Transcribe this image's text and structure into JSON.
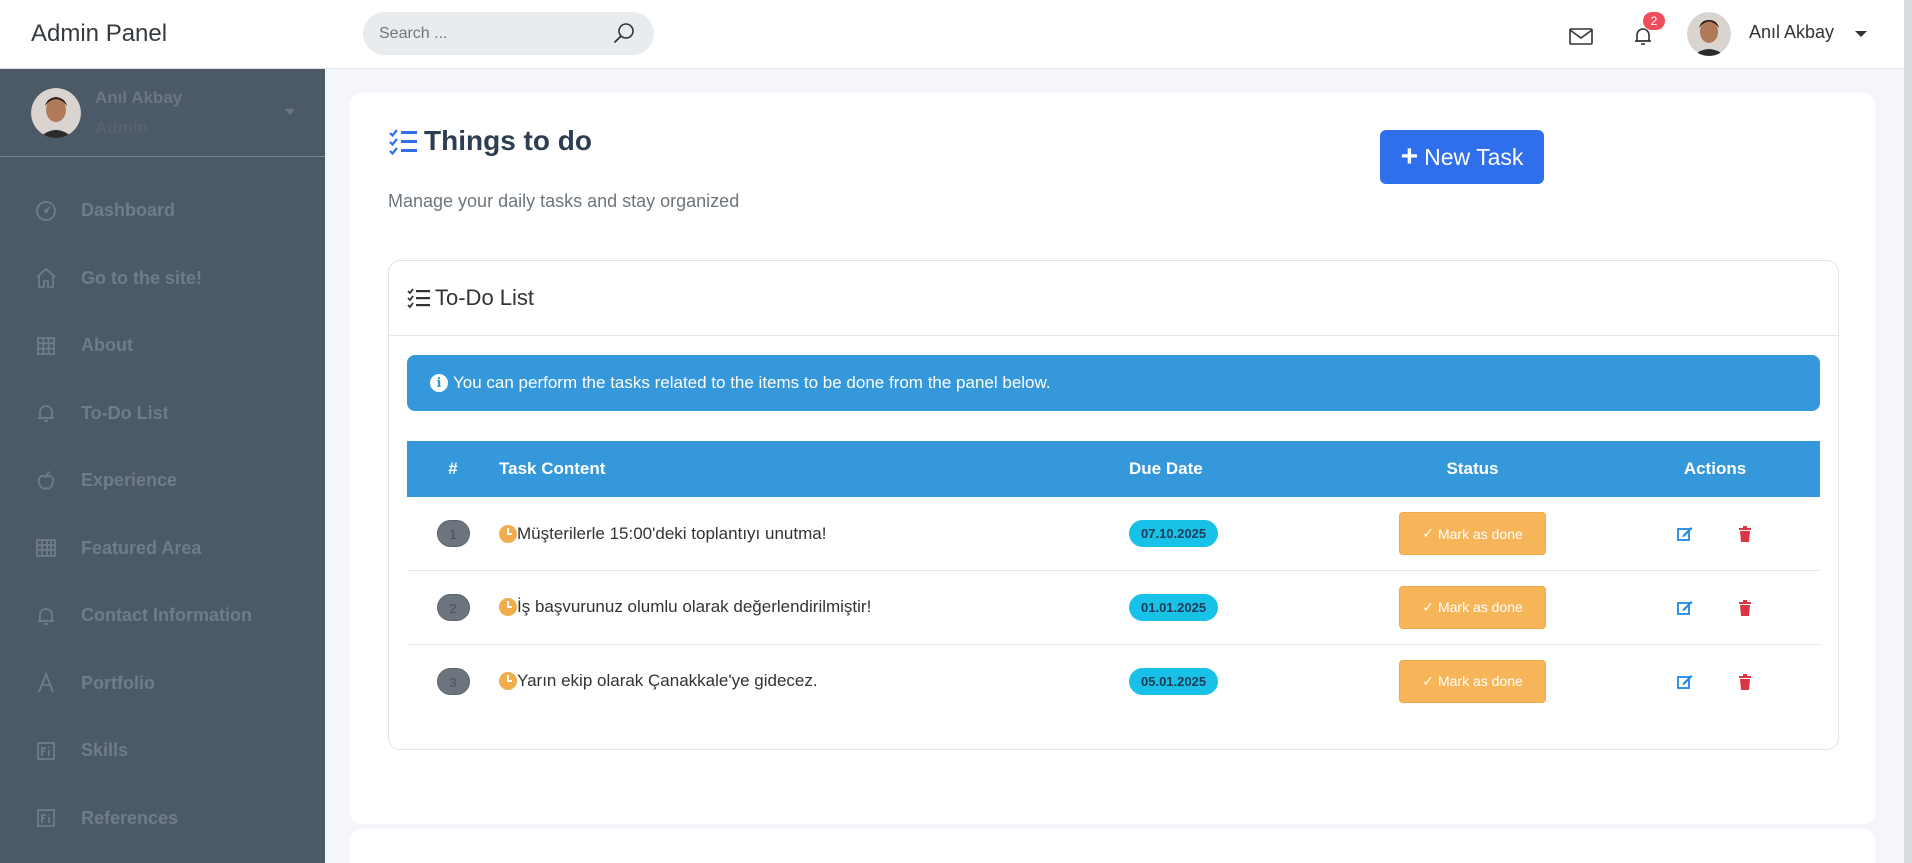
{
  "brand": "Admin Panel",
  "sidebar": {
    "user_name": "Anıl Akbay",
    "user_role": "Admin",
    "items": [
      {
        "label": "Dashboard",
        "icon": "gauge-icon"
      },
      {
        "label": "Go to the site!",
        "icon": "home-icon"
      },
      {
        "label": "About",
        "icon": "grid-icon"
      },
      {
        "label": "To-Do List",
        "icon": "bell-icon"
      },
      {
        "label": "Experience",
        "icon": "apple-icon"
      },
      {
        "label": "Featured Area",
        "icon": "table-icon"
      },
      {
        "label": "Contact Information",
        "icon": "bell-icon"
      },
      {
        "label": "Portfolio",
        "icon": "letter-a-icon"
      },
      {
        "label": "Skills",
        "icon": "fi-icon"
      },
      {
        "label": "References",
        "icon": "fi-icon"
      }
    ]
  },
  "topbar": {
    "search_placeholder": "Search ...",
    "notification_count": "2",
    "user_name": "Anıl Akbay"
  },
  "page": {
    "title": "Things to do",
    "subtitle": "Manage your daily tasks and stay organized",
    "new_task_label": "New Task"
  },
  "todo": {
    "card_title": "To-Do List",
    "alert_text": "You can perform the tasks related to the items to be done from the panel below.",
    "columns": [
      "#",
      "Task Content",
      "Due Date",
      "Status",
      "Actions"
    ],
    "rows": [
      {
        "num": "1",
        "content": "Müşterilerle 15:00'deki toplantıyı unutma!",
        "due": "07.10.2025",
        "status": "Mark as done"
      },
      {
        "num": "2",
        "content": "İş başvurunuz olumlu olarak değerlendirilmiştir!",
        "due": "01.01.2025",
        "status": "Mark as done"
      },
      {
        "num": "3",
        "content": "Yarın ekip olarak Çanakkale'ye gidecez.",
        "due": "05.01.2025",
        "status": "Mark as done"
      }
    ]
  },
  "colors": {
    "sidebar_bg": "#4c5967",
    "primary": "#2f6fec",
    "info": "#3498db",
    "warning": "#f7b55a",
    "pill": "#17c1e8",
    "danger": "#dc3545"
  }
}
